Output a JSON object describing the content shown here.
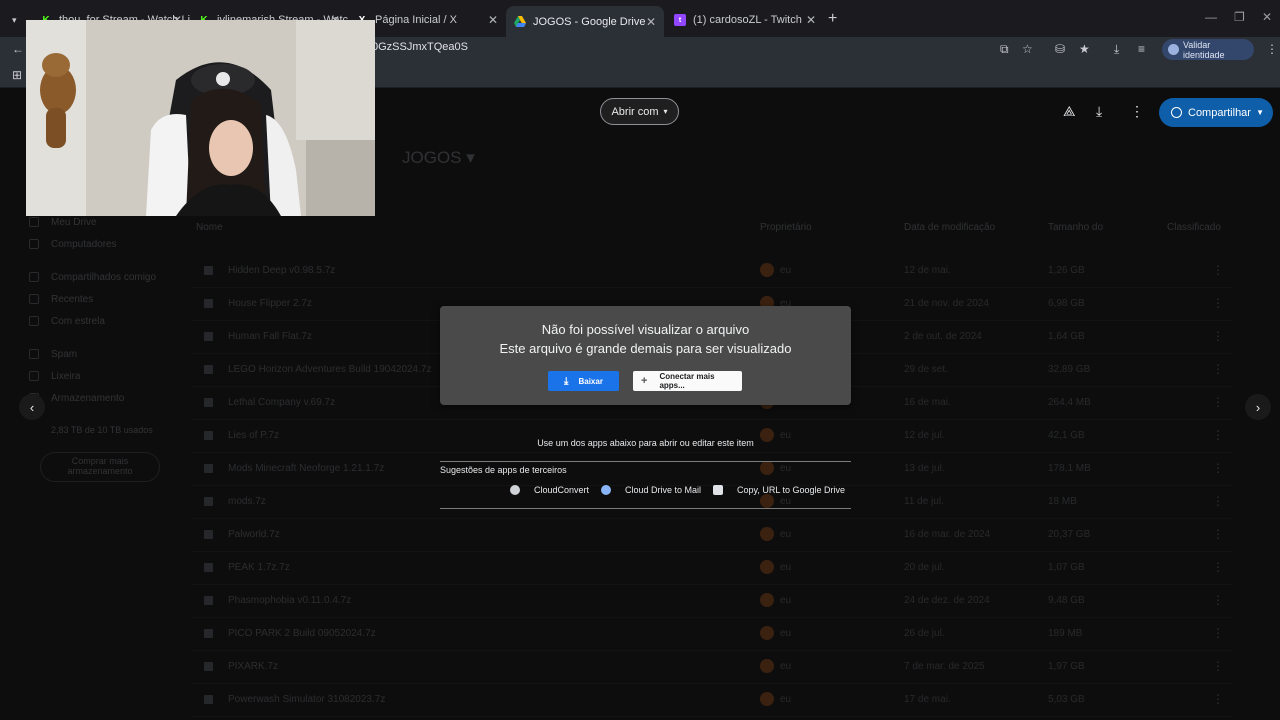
{
  "tabs": [
    {
      "label": "thou_for Stream - Watch Live ...",
      "favicon": "kick-icon",
      "color": "#53fc18",
      "active": false
    },
    {
      "label": "jvlinemarish Stream - Watch L...",
      "favicon": "kick-icon",
      "color": "#53fc18",
      "active": false
    },
    {
      "label": "Página Inicial / X",
      "favicon": "x-icon",
      "color": "#ffffff",
      "active": false
    },
    {
      "label": "JOGOS - Google Drive",
      "favicon": "drive-icon",
      "color": "#fbbc04",
      "active": true
    },
    {
      "label": "(1) cardosoZL - Twitch",
      "favicon": "twitch-icon",
      "color": "#9146ff",
      "active": false
    }
  ],
  "address_bar": {
    "url_fragment": "0GzSSJmxTQea0S"
  },
  "identity_button": {
    "label": "Validar identidade"
  },
  "viewer": {
    "open_with_label": "Abrir com",
    "share_label": "Compartilhar"
  },
  "dialog": {
    "line1": "Não foi possível visualizar o arquivo",
    "line2": "Este arquivo é grande demais para ser visualizado",
    "download_label": "Baixar",
    "connect_label": "Conectar mais apps..."
  },
  "suggestions": {
    "hint": "Use um dos apps abaixo para abrir ou editar este item",
    "title": "Sugestões de apps de terceiros",
    "apps": [
      {
        "label": "CloudConvert",
        "icon": "cloudconvert-icon",
        "color": "#cfd3d8"
      },
      {
        "label": "Cloud Drive to Mail",
        "icon": "cloud-drive-mail-icon",
        "color": "#8ab4f8"
      },
      {
        "label": "Copy, URL to Google Drive",
        "icon": "copy-url-icon",
        "color": "#dfe3e8"
      }
    ]
  },
  "drive": {
    "folder_title": "JOGOS",
    "sidebar": [
      "Meu Drive",
      "Computadores",
      "Compartilhados comigo",
      "Recentes",
      "Com estrela",
      "Spam",
      "Lixeira",
      "Armazenamento",
      "2,83 TB de 10 TB usados",
      "Comprar mais armazenamento"
    ],
    "columns": [
      "Nome",
      "Proprietário",
      "Data de modificação",
      "Tamanho do",
      "Classificado"
    ],
    "files": [
      {
        "name": "Hidden Deep v0.98.5.7z",
        "owner": "eu",
        "date": "12 de mai.",
        "size": "1,26 GB"
      },
      {
        "name": "House Flipper 2.7z",
        "owner": "eu",
        "date": "21 de nov. de 2024",
        "size": "6,98 GB"
      },
      {
        "name": "Human Fall Flat.7z",
        "owner": "eu",
        "date": "2 de out. de 2024",
        "size": "1,64 GB"
      },
      {
        "name": "LEGO Horizon Adventures Build 19042024.7z",
        "owner": "eu",
        "date": "29 de set.",
        "size": "32,89 GB"
      },
      {
        "name": "Lethal Company v.69.7z",
        "owner": "eu",
        "date": "16 de mai.",
        "size": "264,4 MB"
      },
      {
        "name": "Lies of P.7z",
        "owner": "eu",
        "date": "12 de jul.",
        "size": "42,1 GB"
      },
      {
        "name": "Mods Minecraft Neoforge 1.21.1.7z",
        "owner": "eu",
        "date": "13 de jul.",
        "size": "178,1 MB"
      },
      {
        "name": "mods.7z",
        "owner": "eu",
        "date": "11 de jul.",
        "size": "18 MB"
      },
      {
        "name": "Palworld.7z",
        "owner": "eu",
        "date": "16 de mar. de 2024",
        "size": "20,37 GB"
      },
      {
        "name": "PEAK 1.7z.7z",
        "owner": "eu",
        "date": "20 de jul.",
        "size": "1,07 GB"
      },
      {
        "name": "Phasmophobia v0.11.0.4.7z",
        "owner": "eu",
        "date": "24 de dez. de 2024",
        "size": "9,48 GB"
      },
      {
        "name": "PICO PARK 2 Build 09052024.7z",
        "owner": "eu",
        "date": "26 de jul.",
        "size": "189 MB"
      },
      {
        "name": "PIXARK.7z",
        "owner": "eu",
        "date": "7 de mar. de 2025",
        "size": "1,97 GB"
      },
      {
        "name": "Powerwash Simulator 31082023.7z",
        "owner": "eu",
        "date": "17 de mai.",
        "size": "5,03 GB"
      }
    ]
  }
}
